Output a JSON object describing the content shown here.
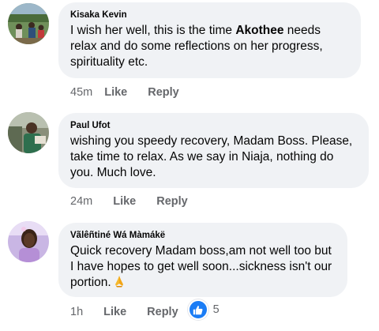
{
  "comments": [
    {
      "author": "Kisaka Kevin",
      "text_before": "I wish her well, this is the time ",
      "text_bold": "Akothee",
      "text_after": " needs relax and do some reflections on her progress, spirituality etc.",
      "time": "45m",
      "like_label": "Like",
      "reply_label": "Reply"
    },
    {
      "author": "Paul Ufot",
      "text": "wishing you speedy recovery, Madam Boss.  Please, take time to relax. As we say in Niaja, nothing do you. Much love.",
      "time": "24m",
      "like_label": "Like",
      "reply_label": "Reply"
    },
    {
      "author": "Vãlêñtiné Wá Màmákë",
      "text": "Quick recovery Madam boss,am not well too but I have hopes to get well soon...sickness isn't our portion.",
      "emoji_icon": "folded-hands-icon",
      "time": "1h",
      "like_label": "Like",
      "reply_label": "Reply",
      "reaction_icon": "thumbs-up-icon",
      "reaction_count": "5"
    }
  ],
  "colors": {
    "bubble": "#f0f2f5",
    "meta_text": "#65676b",
    "like_blue": "#1a7cf5"
  }
}
